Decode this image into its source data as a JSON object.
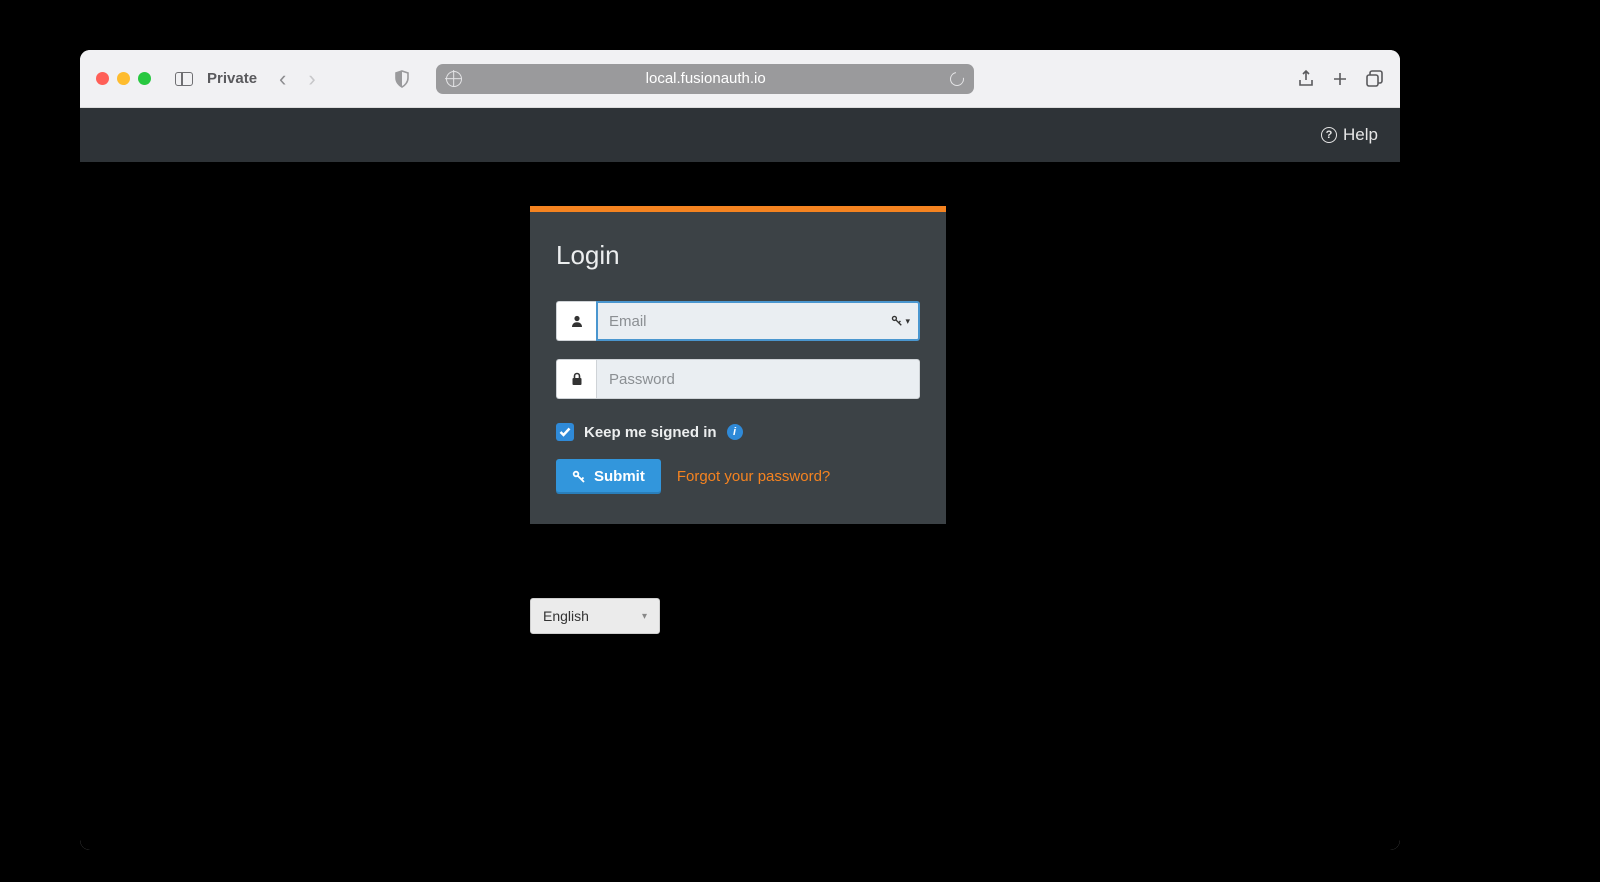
{
  "browser": {
    "private_label": "Private",
    "url": "local.fusionauth.io"
  },
  "header": {
    "help_label": "Help"
  },
  "login": {
    "title": "Login",
    "email_placeholder": "Email",
    "email_value": "",
    "password_placeholder": "Password",
    "password_value": "",
    "keep_signed_label": "Keep me signed in",
    "keep_signed_checked": true,
    "submit_label": "Submit",
    "forgot_label": "Forgot your password?"
  },
  "lang": {
    "selected": "English"
  }
}
